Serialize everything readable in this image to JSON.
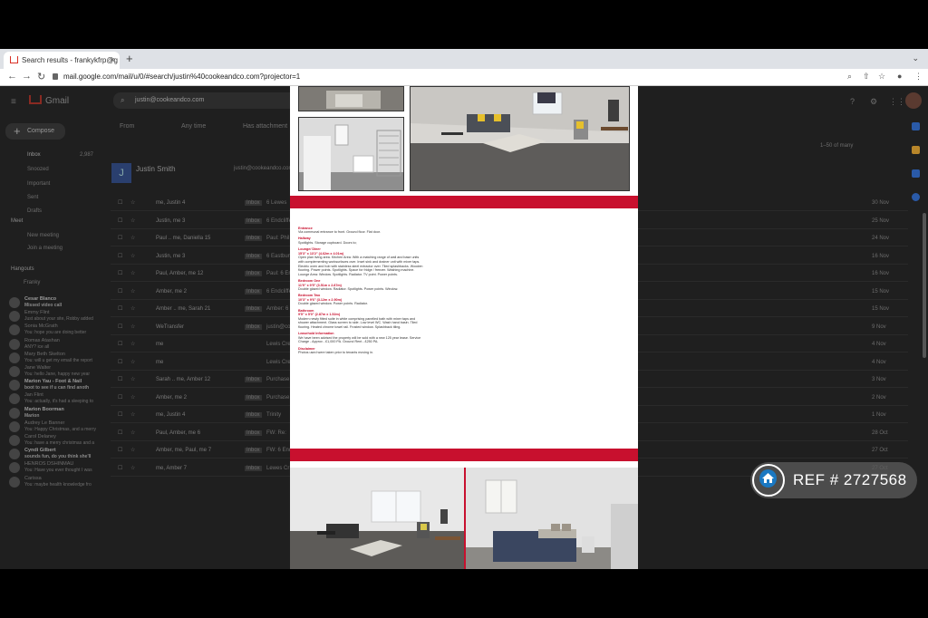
{
  "browser": {
    "tab_title": "Search results - frankykfrp@g",
    "tab_close": "×",
    "new_tab": "+",
    "url": "mail.google.com/mail/u/0/#search/justin%40cookeandco.com?projector=1"
  },
  "gmail": {
    "logo_text": "Gmail",
    "search_value": "justin@cookeandco.com",
    "compose_label": "Compose",
    "filters": [
      "From",
      "Any time",
      "Has attachment"
    ],
    "pagination": "1–50 of many",
    "contact_name": "Justin Smith",
    "contact_email": "justin@cookeandco.com",
    "nav": [
      {
        "label": "Inbox",
        "count": "2,987"
      },
      {
        "label": "Snoozed"
      },
      {
        "label": "Important"
      },
      {
        "label": "Sent"
      },
      {
        "label": "Drafts"
      }
    ],
    "meet_heading": "Meet",
    "meet_items": [
      "New meeting",
      "Join a meeting"
    ],
    "hangouts_heading": "Hangouts",
    "hangouts_user": "Franky",
    "hangouts": [
      {
        "name": "Cesar Blanco",
        "msg": "Missed video call",
        "bold": true
      },
      {
        "name": "Emmy Flint",
        "msg": "Just about your site, Robby added",
        "bold": false
      },
      {
        "name": "Sonia McGrath",
        "msg": "You: hope you are doing better",
        "bold": false
      },
      {
        "name": "Romas Atashan",
        "msg": "ANY? ice all",
        "bold": false
      },
      {
        "name": "Mary Beth Skelton",
        "msg": "You: will u get my email the report",
        "bold": false
      },
      {
        "name": "Jane Walter",
        "msg": "You: hello Jane, happy new year",
        "bold": false
      },
      {
        "name": "Marion Yau - Foot & Nail",
        "msg": "boot to see if u can find anoth",
        "bold": true
      },
      {
        "name": "Jan Flint",
        "msg": "You: actually, it's had a sleeping to",
        "bold": false
      },
      {
        "name": "Marion Boorman",
        "msg": "Marion",
        "bold": true
      },
      {
        "name": "Audrey Le Banner",
        "msg": "You: Happy Christmas, and a merry",
        "bold": false
      },
      {
        "name": "Carol Delaney",
        "msg": "You: have a merry christmas and a",
        "bold": false
      },
      {
        "name": "Cyndi Gilbert",
        "msg": "sounds fun, do you think she'll",
        "bold": true
      },
      {
        "name": "HENROS DSHINMAU",
        "msg": "You: Have you ever thought I was",
        "bold": false
      },
      {
        "name": "Carissa",
        "msg": "You: maybe health knowledge fro",
        "bold": false
      }
    ],
    "rows": [
      {
        "sender": "me, Justin 4",
        "label": "Inbox",
        "subject": "6 Lewes",
        "date": "30 Nov"
      },
      {
        "sender": "Justin, me 3",
        "label": "Inbox",
        "subject": "6 Endcliffe",
        "date": "25 Nov"
      },
      {
        "sender": "Paul .. me, Daniella 15",
        "label": "Inbox",
        "subject": "Paul: Phil",
        "date": "24 Nov"
      },
      {
        "sender": "Justin, me 3",
        "label": "Inbox",
        "subject": "6 Eastbury",
        "date": "16 Nov"
      },
      {
        "sender": "Paul, Amber, me 12",
        "label": "Inbox",
        "subject": "Paul: 6 End",
        "date": "16 Nov"
      },
      {
        "sender": "Amber, me 2",
        "label": "Inbox",
        "subject": "6 Endcliffe",
        "date": "15 Nov"
      },
      {
        "sender": "Amber .. me, Sarah 21",
        "label": "Inbox",
        "subject": "Amber: 6 Endcliffe",
        "date": "15 Nov"
      },
      {
        "sender": "WeTransfer",
        "label": "Inbox",
        "subject": "justin@cookeandco.com",
        "date": "9 Nov"
      },
      {
        "sender": "me",
        "label": "",
        "subject": "Lewis Crescent",
        "date": "4 Nov"
      },
      {
        "sender": "me",
        "label": "",
        "subject": "Lewis Crescent",
        "date": "4 Nov"
      },
      {
        "sender": "Sarah .. me, Amber 12",
        "label": "Inbox",
        "subject": "Purchase",
        "date": "3 Nov"
      },
      {
        "sender": "Amber, me 2",
        "label": "Inbox",
        "subject": "Purchase",
        "date": "2 Nov"
      },
      {
        "sender": "me, Justin 4",
        "label": "Inbox",
        "subject": "Trinity",
        "date": "1 Nov"
      },
      {
        "sender": "Paul, Amber, me 6",
        "label": "Inbox",
        "subject": "FW: Re:",
        "date": "28 Oct"
      },
      {
        "sender": "Amber, me, Paul, me 7",
        "label": "Inbox",
        "subject": "FW: 6 End",
        "date": "27 Oct"
      },
      {
        "sender": "me, Amber 7",
        "label": "Inbox",
        "subject": "Lewes Cr",
        "date": "27 Oct"
      }
    ]
  },
  "document": {
    "sections": [
      {
        "heading": "Entrance",
        "dims": "",
        "body": "Via communal entrance to front. Ground floor. Flat door."
      },
      {
        "heading": "Hallway",
        "dims": "",
        "body": "Spotlights. Storage cupboard. Doors to;"
      },
      {
        "heading": "Lounge/ Diner",
        "dims": "15'3\" x 13'2\" (4.62m x 4.01m)",
        "body": "Open plan living area. Kitchen Area: With a matching range of wall and base units with complementing worksurfaces over. Inset sink and drainer unit with mixer taps. Electric oven and hob with stainless steel extractor over. Tiled splashbacks. Wooden flooring. Power points. Spotlights. Space for fridge / freezer. Washing machine. Lounge Area: Window. Spotlights. Radiator. TV point. Power points."
      },
      {
        "heading": "Bedroom One",
        "dims": "11'9\" x 9'5\" (3.51m x 2.87m)",
        "body": "Double glazed window. Radiator. Spotlights. Power points. Window."
      },
      {
        "heading": "Bedroom Two",
        "dims": "10'3\" x 9'6\" (3.12m x 2.90m)",
        "body": "Double glazed window. Power points. Radiator."
      },
      {
        "heading": "Bathroom",
        "dims": "9'5\" x 5'0\" (2.87m x 1.52m)",
        "body": "Modern newly fitted suite in white comprising panelled bath with mixer taps and shower attachment. Glass screen to side. Low level WC. Wash hand basin. Tiled flooring. Heated chrome towel rail. Frosted window. Splashback tiling."
      },
      {
        "heading": "Leasehold Information",
        "dims": "",
        "body": "We have been advised the property will be sold with a new 125 year lease. Service Charge - Approx - £1,000 PA. Ground Rent - £250 PA."
      },
      {
        "heading": "Disclaimer",
        "dims": "",
        "body": "Photos used were taken prior to tenants moving in."
      }
    ]
  },
  "watermark": {
    "ref_text": "REF # 2727568"
  },
  "colors": {
    "brand_red": "#c8102e",
    "badge_blue": "#1a78c2"
  }
}
